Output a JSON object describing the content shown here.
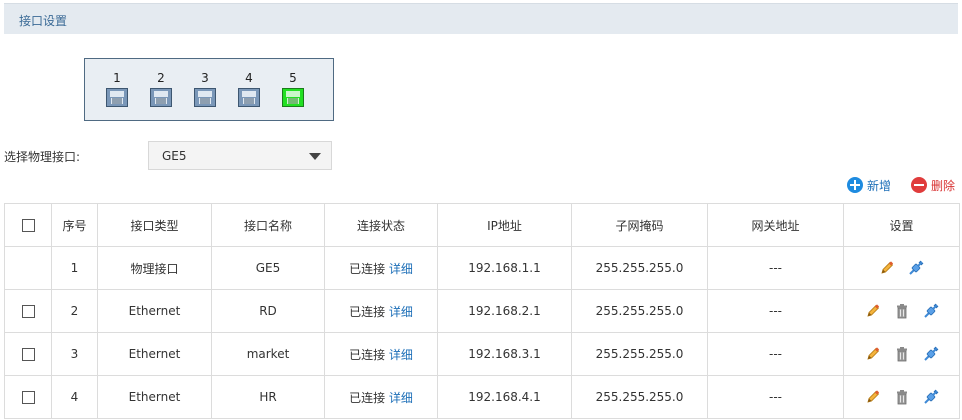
{
  "header": {
    "title": "接口设置"
  },
  "ports": [
    {
      "label": "1",
      "active": false
    },
    {
      "label": "2",
      "active": false
    },
    {
      "label": "3",
      "active": false
    },
    {
      "label": "4",
      "active": false
    },
    {
      "label": "5",
      "active": true
    }
  ],
  "colors": {
    "port_idle": "#7a97b8",
    "port_active": "#22e022",
    "add": "#1e8be0",
    "delete": "#e03c3c",
    "header_bg": "#e4eaf0"
  },
  "select": {
    "label": "选择物理接口:",
    "value": "GE5"
  },
  "actions": {
    "add_label": "新增",
    "delete_label": "删除"
  },
  "table": {
    "headers": {
      "index": "序号",
      "type": "接口类型",
      "name": "接口名称",
      "status": "连接状态",
      "ip": "IP地址",
      "mask": "子网掩码",
      "gateway": "网关地址",
      "settings": "设置"
    },
    "rows": [
      {
        "index": "1",
        "type": "物理接口",
        "name": "GE5",
        "status": "已连接",
        "detail": "详细",
        "ip": "192.168.1.1",
        "mask": "255.255.255.0",
        "gateway": "---"
      },
      {
        "index": "2",
        "type": "Ethernet",
        "name": "RD",
        "status": "已连接",
        "detail": "详细",
        "ip": "192.168.2.1",
        "mask": "255.255.255.0",
        "gateway": "---"
      },
      {
        "index": "3",
        "type": "Ethernet",
        "name": "market",
        "status": "已连接",
        "detail": "详细",
        "ip": "192.168.3.1",
        "mask": "255.255.255.0",
        "gateway": "---"
      },
      {
        "index": "4",
        "type": "Ethernet",
        "name": "HR",
        "status": "已连接",
        "detail": "详细",
        "ip": "192.168.4.1",
        "mask": "255.255.255.0",
        "gateway": "---"
      }
    ]
  }
}
